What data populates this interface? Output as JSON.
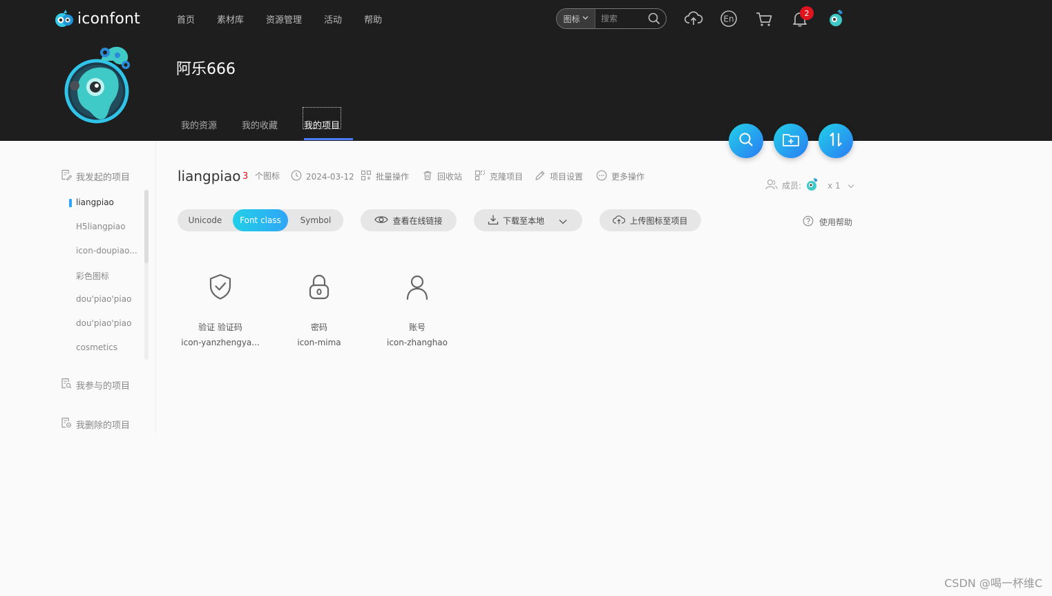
{
  "topnav": {
    "logo_text": "iconfont",
    "links": [
      "首页",
      "素材库",
      "资源管理",
      "活动",
      "帮助"
    ],
    "search": {
      "type_label": "图标",
      "placeholder": "搜索"
    },
    "notification_count": "2"
  },
  "profile": {
    "username": "阿乐666",
    "tabs": [
      "我的资源",
      "我的收藏",
      "我的项目"
    ],
    "active_tab": "我的项目"
  },
  "sidebar": {
    "created_label": "我发起的项目",
    "projects": [
      "liangpiao",
      "H5liangpiao",
      "icon-doupiao...",
      "彩色图标",
      "dou'piao'piao",
      "dou'piao'piao",
      "cosmetics"
    ],
    "active_project": "liangpiao",
    "joined_label": "我参与的项目",
    "deleted_label": "我删除的项目"
  },
  "project": {
    "name": "liangpiao",
    "count": "3",
    "count_unit": "个图标",
    "date": "2024-03-12",
    "actions": [
      "批量操作",
      "回收站",
      "克隆项目",
      "项目设置",
      "更多操作"
    ],
    "members_label": "成员:",
    "members_count": "x 1"
  },
  "toolbar": {
    "modes": [
      "Unicode",
      "Font class",
      "Symbol"
    ],
    "active_mode": "Font class",
    "view_online": "查看在线链接",
    "download": "下载至本地",
    "upload": "上传图标至项目",
    "help": "使用帮助"
  },
  "icons": [
    {
      "name": "验证 验证码",
      "class": "icon-yanzhengya...",
      "icon": "shield-check-icon"
    },
    {
      "name": "密码",
      "class": "icon-mima",
      "icon": "lock-icon"
    },
    {
      "name": "账号",
      "class": "icon-zhanghao",
      "icon": "user-icon"
    }
  ],
  "watermark": "CSDN @喝一杯维C",
  "colors": {
    "header_bg": "#1e1e1e",
    "accent": "#22d1e8",
    "badge": "#e0141e",
    "count": "#e0141e"
  }
}
